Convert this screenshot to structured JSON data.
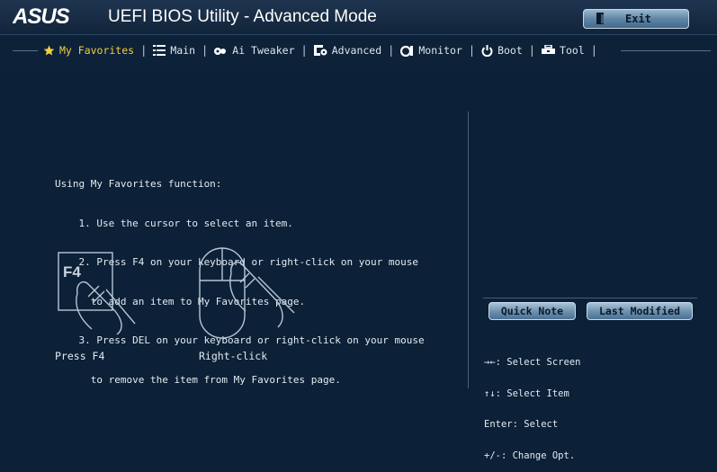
{
  "header": {
    "brand": "ASUS",
    "title": "UEFI BIOS Utility - Advanced Mode",
    "exit_label": "Exit"
  },
  "nav": {
    "tabs": [
      {
        "label": "My Favorites",
        "icon": "star-icon",
        "active": true
      },
      {
        "label": "Main",
        "icon": "list-icon",
        "active": false
      },
      {
        "label": "Ai Tweaker",
        "icon": "tweaker-icon",
        "active": false
      },
      {
        "label": "Advanced",
        "icon": "advanced-icon",
        "active": false
      },
      {
        "label": "Monitor",
        "icon": "monitor-icon",
        "active": false
      },
      {
        "label": "Boot",
        "icon": "power-icon",
        "active": false
      },
      {
        "label": "Tool",
        "icon": "tool-icon",
        "active": false
      }
    ],
    "separator": "|"
  },
  "instructions": {
    "heading": "Using My Favorites function:",
    "lines": [
      "    1. Use the cursor to select an item.",
      "    2. Press F4 on your keyboard or right-click on your mouse",
      "      to add an item to My Favorites page.",
      "    3. Press DEL on your keyboard or right-click on your mouse",
      "      to remove the item from My Favorites page."
    ]
  },
  "illustrations": {
    "key_label": "F4",
    "press_caption": "Press F4",
    "click_caption": "Right-click"
  },
  "side_panel": {
    "quick_note_label": "Quick Note",
    "last_modified_label": "Last Modified",
    "help": [
      "→←: Select Screen",
      "↑↓: Select Item",
      "Enter: Select",
      "+/-: Change Opt."
    ]
  },
  "colors": {
    "background": "#0c2037",
    "active_tab": "#f3cf3f",
    "text": "#e2ebf2"
  }
}
